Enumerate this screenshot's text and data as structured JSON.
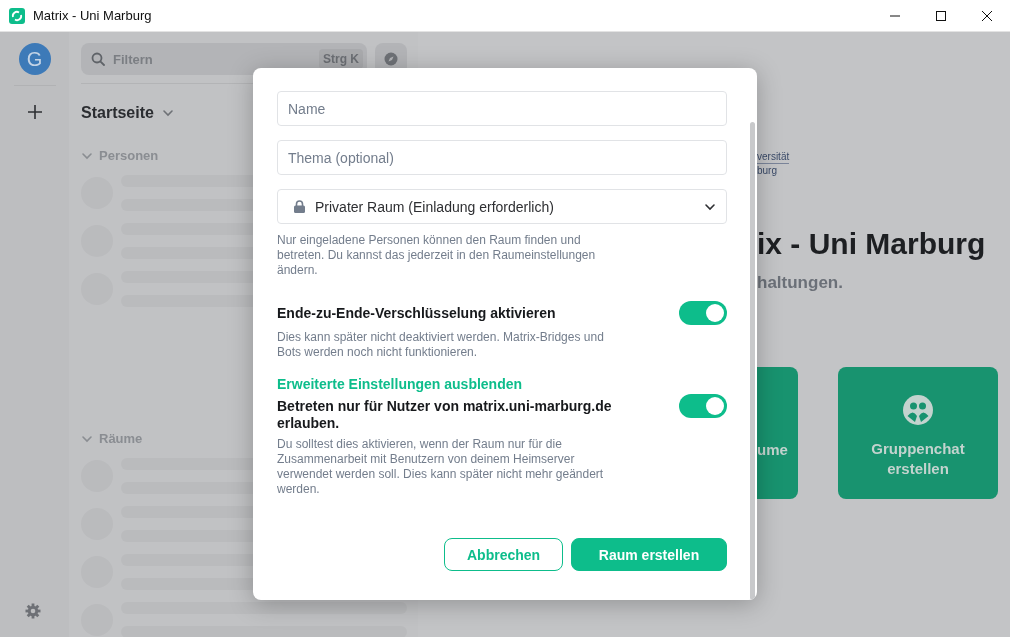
{
  "window": {
    "title": "Matrix - Uni Marburg"
  },
  "rail": {
    "avatar": "G"
  },
  "sidebar": {
    "search": {
      "placeholder": "Filtern",
      "shortcut": "Strg K"
    },
    "heading": "Startseite",
    "sections": [
      {
        "label": "Personen",
        "expanded": true
      },
      {
        "label": "Räume",
        "expanded": true
      }
    ]
  },
  "main": {
    "logo_lines": [
      "versität",
      "burg"
    ],
    "title": "ix - Uni Marburg",
    "subtitle": "haltungen.",
    "cards": [
      {
        "label": "ume"
      },
      {
        "label": "Gruppenchat erstellen"
      }
    ]
  },
  "dialog": {
    "fields": [
      {
        "placeholder": "Name"
      },
      {
        "placeholder": "Thema (optional)"
      }
    ],
    "visibility": {
      "value": "Privater Raum (Einladung erforderlich)",
      "help": "Nur eingeladene Personen können den Raum finden und betreten. Du kannst das jederzeit in den Raumeinstellungen ändern."
    },
    "encryption": {
      "label": "Ende-zu-Ende-Verschlüsselung aktivieren",
      "description": "Dies kann später nicht deaktiviert werden. Matrix-Bridges und Bots werden noch nicht funktionieren.",
      "on": true
    },
    "advanced_link": "Erweiterte Einstellungen ausblenden",
    "restrict": {
      "label": "Betreten nur für Nutzer von matrix.uni-marburg.de erlauben.",
      "description": "Du solltest dies aktivieren, wenn der Raum nur für die Zusammenarbeit mit Benutzern von deinem Heimserver verwendet werden soll. Dies kann später nicht mehr geändert werden.",
      "on": true
    },
    "buttons": [
      {
        "label": "Abbrechen",
        "kind": "secondary"
      },
      {
        "label": "Raum erstellen",
        "kind": "primary"
      }
    ]
  }
}
